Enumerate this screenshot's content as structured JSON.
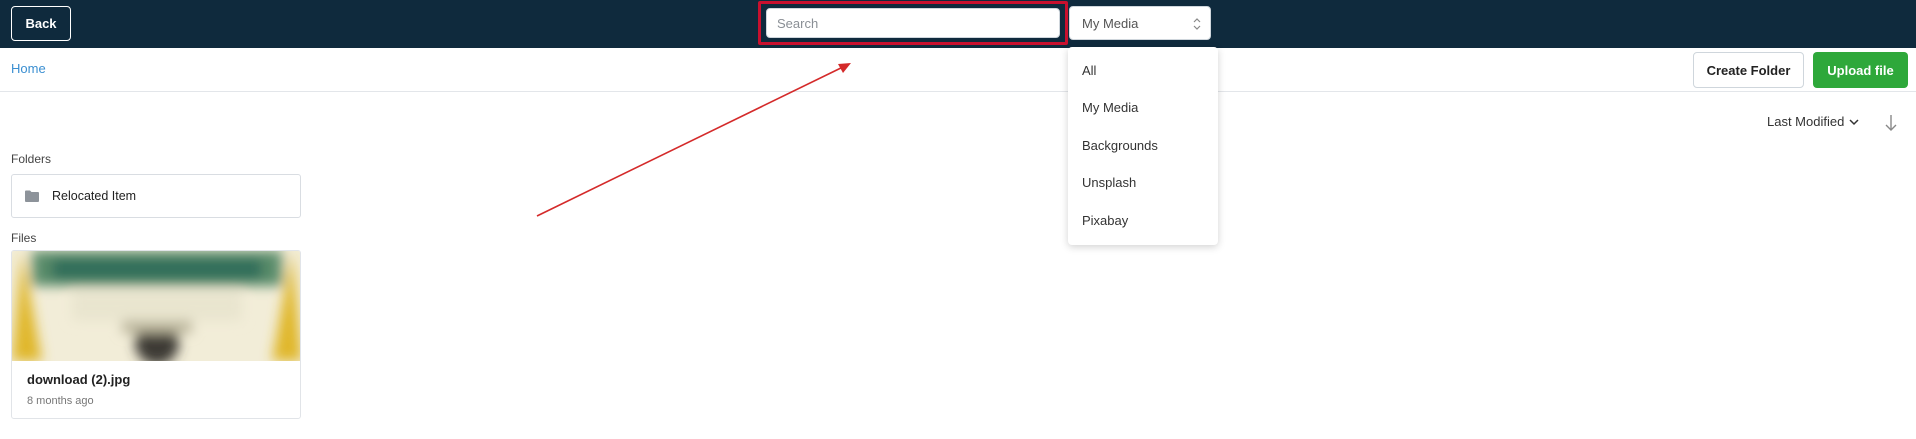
{
  "topbar": {
    "back_label": "Back",
    "search_placeholder": "Search",
    "source_selected": "My Media"
  },
  "breadcrumb": {
    "home_label": "Home"
  },
  "actions": {
    "create_folder_label": "Create Folder",
    "upload_file_label": "Upload file"
  },
  "sort": {
    "label": "Last Modified"
  },
  "folders": {
    "label": "Folders",
    "items": [
      {
        "name": "Relocated Item"
      }
    ]
  },
  "files": {
    "label": "Files",
    "items": [
      {
        "name": "download (2).jpg",
        "modified": "8 months ago"
      }
    ]
  },
  "source_dropdown": {
    "options": [
      "All",
      "My Media",
      "Backgrounds",
      "Unsplash",
      "Pixabay"
    ]
  },
  "colors": {
    "topbar": "#0f2a3d",
    "link": "#3b8fd1",
    "upload_button": "#2ea83a",
    "highlight_annotation": "#c8102e"
  },
  "icons": {
    "folder": "folder-icon",
    "sort_chevron": "chevron-down-icon",
    "sort_direction": "arrow-down-icon",
    "select_arrows": "updown-chevron-icon"
  }
}
